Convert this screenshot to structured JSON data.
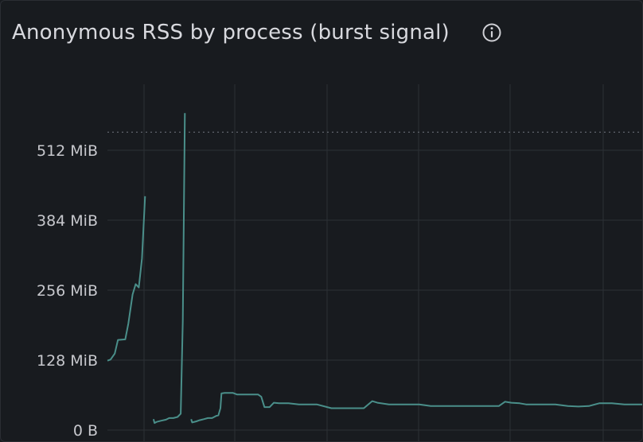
{
  "panel": {
    "title": "Anonymous RSS by process (burst signal)",
    "info_icon": "info-circle-icon"
  },
  "colors": {
    "background": "#181b1f",
    "grid": "#2c3036",
    "series": "#4a8f8a",
    "threshold": "#5a5e66",
    "text": "#d8d9de"
  },
  "chart_data": {
    "type": "line",
    "title": "Anonymous RSS by process (burst signal)",
    "xlabel": "",
    "ylabel": "",
    "y_unit": "MiB",
    "ylim": [
      0,
      580
    ],
    "y_ticks": [
      {
        "value": 0,
        "label": "0 B"
      },
      {
        "value": 128,
        "label": "128 MiB"
      },
      {
        "value": 256,
        "label": "256 MiB"
      },
      {
        "value": 384,
        "label": "384 MiB"
      },
      {
        "value": 512,
        "label": "512 MiB"
      }
    ],
    "threshold_line": 545,
    "grid": true,
    "legend": "none",
    "x_tick_labels_visible": false,
    "series": [
      {
        "points": [
          [
            0,
            127
          ],
          [
            3,
            129
          ],
          [
            7,
            140
          ],
          [
            10,
            165
          ],
          [
            17,
            166
          ],
          [
            20,
            195
          ],
          [
            24,
            248
          ],
          [
            27,
            267
          ],
          [
            30,
            261
          ],
          [
            33,
            314
          ],
          [
            36,
            428
          ]
        ]
      },
      {
        "points": [
          [
            44,
            20
          ],
          [
            45,
            13
          ],
          [
            47,
            15
          ],
          [
            51,
            17
          ],
          [
            56,
            19
          ],
          [
            59,
            22
          ],
          [
            63,
            22
          ],
          [
            67,
            24
          ],
          [
            70,
            30
          ],
          [
            72,
            200
          ],
          [
            74,
            580
          ]
        ]
      },
      {
        "points": [
          [
            80,
            20
          ],
          [
            81,
            14
          ],
          [
            85,
            16
          ],
          [
            88,
            18
          ],
          [
            92,
            20
          ],
          [
            96,
            22
          ],
          [
            100,
            22
          ],
          [
            104,
            26
          ],
          [
            106,
            27
          ],
          [
            108,
            40
          ],
          [
            109,
            67
          ],
          [
            112,
            68
          ],
          [
            120,
            68
          ],
          [
            124,
            65
          ],
          [
            144,
            65
          ],
          [
            147,
            61
          ],
          [
            150,
            42
          ],
          [
            155,
            42
          ],
          [
            159,
            50
          ],
          [
            164,
            49
          ],
          [
            173,
            49
          ],
          [
            183,
            47
          ],
          [
            200,
            47
          ],
          [
            214,
            40
          ],
          [
            229,
            40
          ],
          [
            245,
            40
          ],
          [
            253,
            53
          ],
          [
            258,
            50
          ],
          [
            269,
            47
          ],
          [
            279,
            47
          ],
          [
            298,
            47
          ],
          [
            309,
            44
          ],
          [
            320,
            44
          ],
          [
            340,
            44
          ],
          [
            360,
            44
          ],
          [
            374,
            44
          ],
          [
            380,
            52
          ],
          [
            386,
            50
          ],
          [
            394,
            49
          ],
          [
            400,
            47
          ],
          [
            414,
            47
          ],
          [
            428,
            47
          ],
          [
            440,
            44
          ],
          [
            450,
            43
          ],
          [
            460,
            44
          ],
          [
            470,
            49
          ],
          [
            482,
            49
          ],
          [
            494,
            47
          ],
          [
            502,
            47
          ],
          [
            512,
            47
          ]
        ]
      }
    ]
  }
}
